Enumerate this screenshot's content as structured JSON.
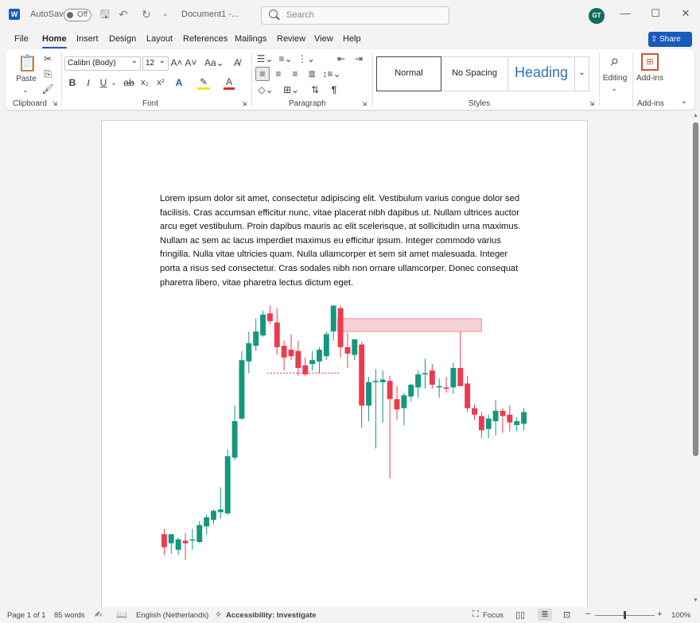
{
  "titlebar": {
    "autosave_label": "AutoSave",
    "autosave_state": "Off",
    "document_title": "Document1  -...",
    "search_placeholder": "Search",
    "user_initials": "GT"
  },
  "menu": {
    "tabs": [
      "File",
      "Home",
      "Insert",
      "Design",
      "Layout",
      "References",
      "Mailings",
      "Review",
      "View",
      "Help"
    ],
    "share_label": "Share"
  },
  "ribbon": {
    "paste_label": "Paste",
    "font_name": "Calibri (Body)",
    "font_size": "12",
    "styles": [
      "Normal",
      "No Spacing",
      "Heading"
    ],
    "editing_label": "Editing",
    "addins_label": "Add-ins",
    "groups": [
      "Clipboard",
      "Font",
      "Paragraph",
      "Styles",
      "Add-ins"
    ]
  },
  "document": {
    "paragraph": "Lorem ipsum dolor sit amet, consectetur adipiscing elit. Vestibulum varius congue dolor sed facilisis. Cras accumsan efficitur nunc, vitae placerat nibh dapibus ut. Nullam ultrices auctor arcu eget vestibulum. Proin dapibus mauris ac elit scelerisque, at sollicitudin urna maximus. Nullam ac sem ac lacus imperdiet maximus eu efficitur ipsum. Integer commodo varius fringilla. Nulla vitae ultricies quam. Nulla ullamcorper et sem sit amet malesuada. Integer porta a risus sed consectetur. Cras sodales nibh non ornare ullamcorper. Donec consequat pharetra libero, vitae pharetra lectus dictum eget."
  },
  "chart_data": {
    "type": "candlestick",
    "up_color": "#15977f",
    "down_color": "#ec3a4f",
    "zone_color": "#f4b3b8",
    "candles": [
      {
        "o": 296,
        "h": 300,
        "l": 280,
        "c": 286
      },
      {
        "o": 289,
        "h": 295,
        "l": 281,
        "c": 296
      },
      {
        "o": 284,
        "h": 293,
        "l": 280,
        "c": 292
      },
      {
        "o": 291,
        "h": 297,
        "l": 276,
        "c": 289
      },
      {
        "o": 292,
        "h": 300,
        "l": 284,
        "c": 292
      },
      {
        "o": 290,
        "h": 306,
        "l": 289,
        "c": 303
      },
      {
        "o": 302,
        "h": 311,
        "l": 296,
        "c": 309
      },
      {
        "o": 307,
        "h": 315,
        "l": 304,
        "c": 314
      },
      {
        "o": 313,
        "h": 332,
        "l": 308,
        "c": 315
      },
      {
        "o": 312,
        "h": 361,
        "l": 311,
        "c": 356
      },
      {
        "o": 355,
        "h": 395,
        "l": 353,
        "c": 383
      },
      {
        "o": 385,
        "h": 437,
        "l": 384,
        "c": 430
      },
      {
        "o": 429,
        "h": 452,
        "l": 420,
        "c": 443
      },
      {
        "o": 441,
        "h": 462,
        "l": 437,
        "c": 452
      },
      {
        "o": 449,
        "h": 468,
        "l": 448,
        "c": 465
      },
      {
        "o": 466,
        "h": 472,
        "l": 458,
        "c": 460
      },
      {
        "o": 459,
        "h": 470,
        "l": 434,
        "c": 440
      },
      {
        "o": 441,
        "h": 445,
        "l": 422,
        "c": 432
      },
      {
        "o": 438,
        "h": 450,
        "l": 430,
        "c": 433
      },
      {
        "o": 437,
        "h": 445,
        "l": 418,
        "c": 424
      },
      {
        "o": 426,
        "h": 432,
        "l": 418,
        "c": 419
      },
      {
        "o": 427,
        "h": 437,
        "l": 422,
        "c": 430
      },
      {
        "o": 429,
        "h": 440,
        "l": 420,
        "c": 438
      },
      {
        "o": 433,
        "h": 452,
        "l": 430,
        "c": 450
      },
      {
        "o": 452,
        "h": 472,
        "l": 445,
        "c": 472
      },
      {
        "o": 470,
        "h": 472,
        "l": 432,
        "c": 440
      },
      {
        "o": 440,
        "h": 451,
        "l": 424,
        "c": 435
      },
      {
        "o": 434,
        "h": 446,
        "l": 430,
        "c": 446
      },
      {
        "o": 442,
        "h": 444,
        "l": 378,
        "c": 395
      },
      {
        "o": 395,
        "h": 417,
        "l": 383,
        "c": 413
      },
      {
        "o": 413,
        "h": 423,
        "l": 362,
        "c": 414
      },
      {
        "o": 413,
        "h": 422,
        "l": 382,
        "c": 415
      },
      {
        "o": 414,
        "h": 418,
        "l": 339,
        "c": 400
      },
      {
        "o": 400,
        "h": 410,
        "l": 384,
        "c": 392
      },
      {
        "o": 393,
        "h": 405,
        "l": 380,
        "c": 403
      },
      {
        "o": 402,
        "h": 412,
        "l": 398,
        "c": 411
      },
      {
        "o": 409,
        "h": 422,
        "l": 401,
        "c": 419
      },
      {
        "o": 419,
        "h": 431,
        "l": 408,
        "c": 420
      },
      {
        "o": 422,
        "h": 427,
        "l": 408,
        "c": 411
      },
      {
        "o": 409,
        "h": 416,
        "l": 401,
        "c": 410
      },
      {
        "o": 409,
        "h": 417,
        "l": 405,
        "c": 408
      },
      {
        "o": 409,
        "h": 428,
        "l": 404,
        "c": 424
      },
      {
        "o": 424,
        "h": 452,
        "l": 410,
        "c": 410
      },
      {
        "o": 412,
        "h": 418,
        "l": 390,
        "c": 393
      },
      {
        "o": 393,
        "h": 396,
        "l": 384,
        "c": 388
      },
      {
        "o": 387,
        "h": 390,
        "l": 370,
        "c": 376
      },
      {
        "o": 377,
        "h": 388,
        "l": 370,
        "c": 385
      },
      {
        "o": 383,
        "h": 399,
        "l": 372,
        "c": 391
      },
      {
        "o": 391,
        "h": 393,
        "l": 374,
        "c": 387
      },
      {
        "o": 388,
        "h": 395,
        "l": 375,
        "c": 382
      },
      {
        "o": 380,
        "h": 386,
        "l": 375,
        "c": 383
      },
      {
        "o": 381,
        "h": 393,
        "l": 376,
        "c": 390
      }
    ],
    "supply_zone": {
      "from_index": 25,
      "to_index": 45,
      "low": 452,
      "high": 462
    },
    "dotted_level": {
      "from_index": 15,
      "to_index": 25,
      "value": 420
    },
    "ylim": [
      268,
      476
    ]
  },
  "status": {
    "page": "Page 1 of 1",
    "words": "85 words",
    "language": "English (Netherlands)",
    "accessibility": "Accessibility: Investigate",
    "focus": "Focus",
    "zoom": "100%"
  }
}
